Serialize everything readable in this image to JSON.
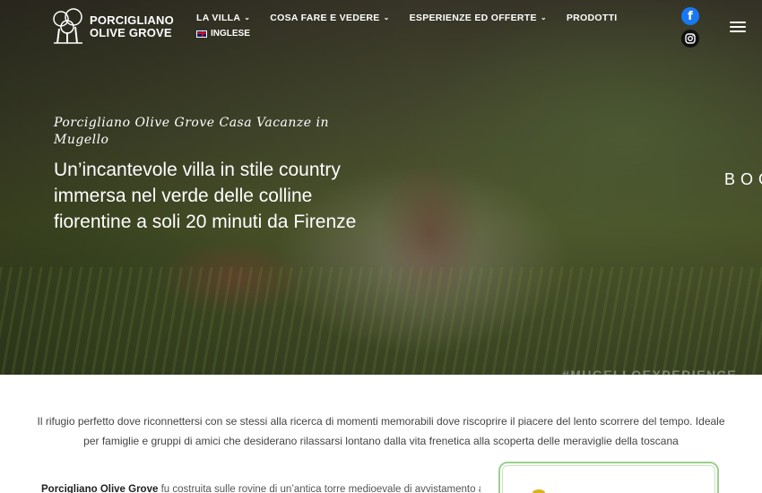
{
  "brand": {
    "line1": "PORCIGLIANO",
    "line2": "OLIVE GROVE"
  },
  "nav": {
    "items": [
      {
        "label": "LA VILLA",
        "has_dropdown": true
      },
      {
        "label": "COSA FARE E VEDERE",
        "has_dropdown": true
      },
      {
        "label": "ESPERIENZE ED OFFERTE",
        "has_dropdown": true
      },
      {
        "label": "PRODOTTI",
        "has_dropdown": false
      }
    ],
    "language": "INGLESE"
  },
  "social": {
    "facebook": "f",
    "icons": [
      "facebook-icon",
      "instagram-icon"
    ]
  },
  "hero": {
    "subtitle": "Porcigliano Olive Grove Casa Vacanze in Mugello",
    "title": "Un’incantevole villa in stile country immersa nel verde delle colline fiorentine a soli 20 minuti da Firenze",
    "book_label": "BOOK",
    "hashtag": "#MUGELLOEXPERIENCE"
  },
  "intro": "Il rifugio perfetto dove riconnettersi con se stessi alla ricerca di momenti memorabili dove riscoprire il piacere del lento scorrere del tempo. Ideale per famiglie e gruppi di amici che desiderano rilassarsi lontano dalla vita frenetica alla scoperta delle meraviglie della toscana",
  "body": {
    "link": "Porcigliano Olive Grove",
    "text": " fu costruita sulle rovine di un’antica torre medioevale di avvistamento a"
  },
  "colors": {
    "facebook": "#1877f2",
    "card_border": "#9fcf8f",
    "accent_yellow": "#d8b51e"
  }
}
